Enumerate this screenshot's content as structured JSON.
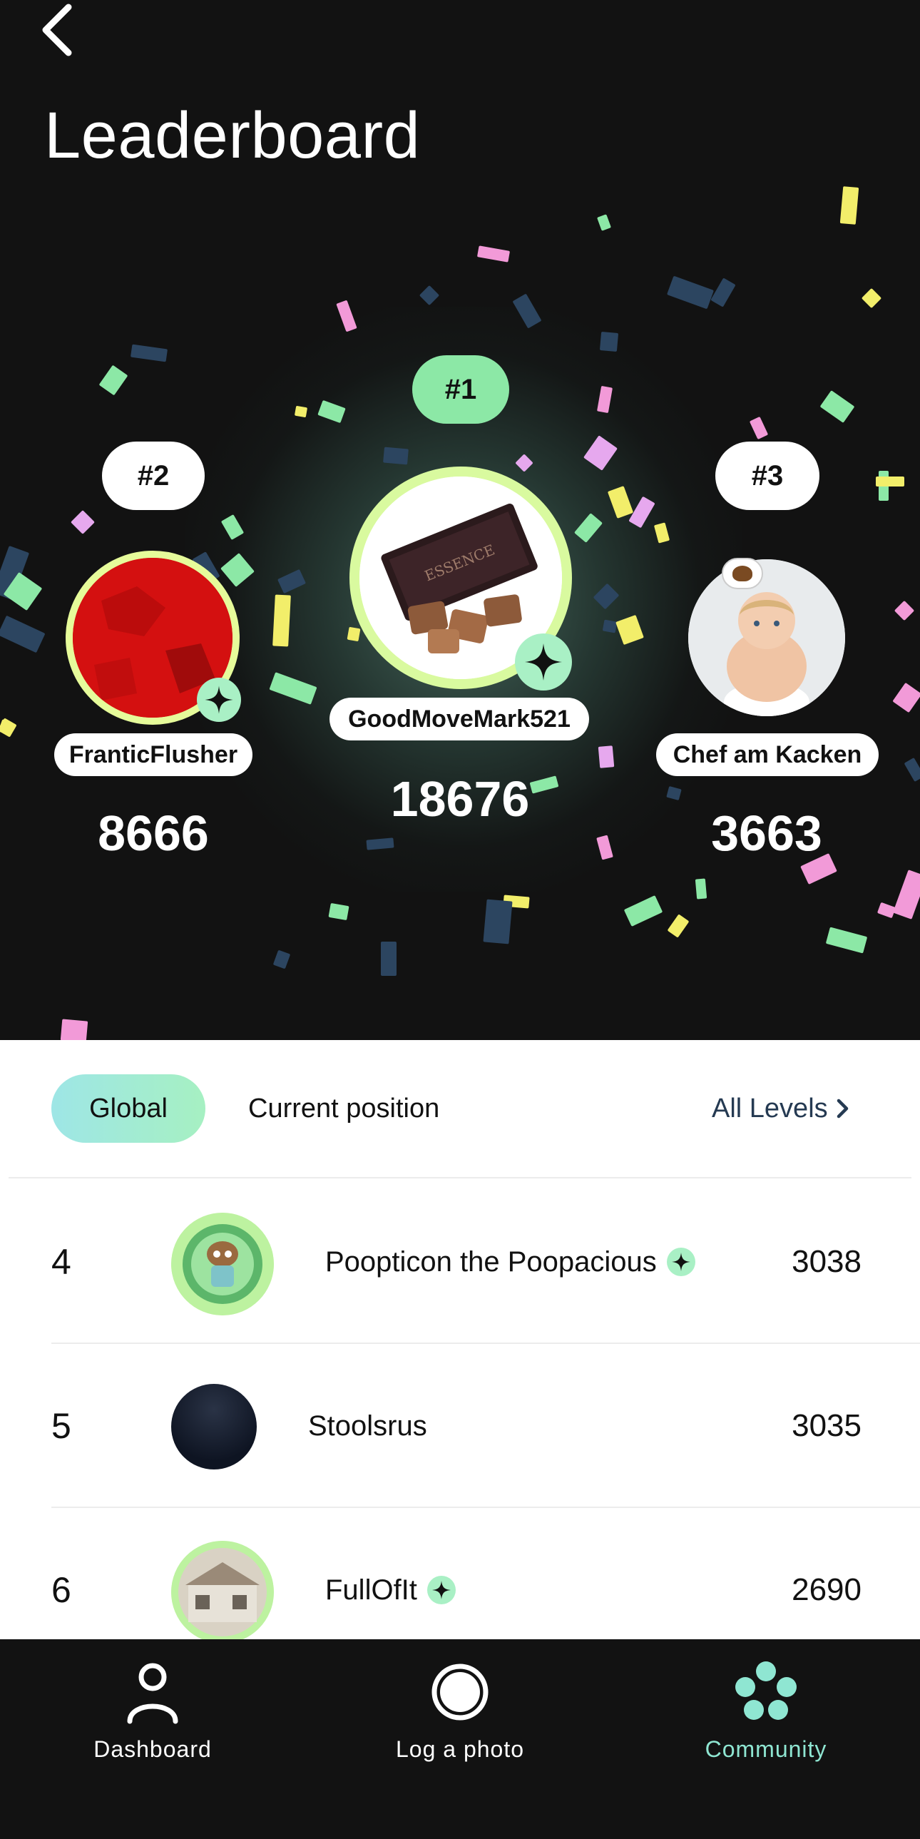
{
  "header": {
    "title": "Leaderboard"
  },
  "podium": [
    {
      "rank_label": "#1",
      "name": "GoodMoveMark521",
      "score": "18676"
    },
    {
      "rank_label": "#2",
      "name": "FranticFlusher",
      "score": "8666"
    },
    {
      "rank_label": "#3",
      "name": "Chef am Kacken",
      "score": "3663"
    }
  ],
  "tabs": {
    "global": "Global",
    "current": "Current position",
    "all_levels": "All Levels"
  },
  "rows": [
    {
      "rank": "4",
      "name": "Poopticon the Poopacious",
      "score": "3038",
      "verified": true
    },
    {
      "rank": "5",
      "name": "Stoolsrus",
      "score": "3035",
      "verified": false
    },
    {
      "rank": "6",
      "name": "FullOfIt",
      "score": "2690",
      "verified": true
    }
  ],
  "nav": {
    "dashboard": "Dashboard",
    "log_photo": "Log a photo",
    "community": "Community"
  },
  "colors": {
    "accent_green": "#8ce8a6",
    "accent_teal": "#8fe6d2",
    "avatar_ring": "#d9fa9f"
  },
  "icons": [
    "back-chevron-icon",
    "sparkle-star-icon",
    "chevron-right-icon",
    "person-icon",
    "camera-ring-icon",
    "community-dots-icon"
  ]
}
